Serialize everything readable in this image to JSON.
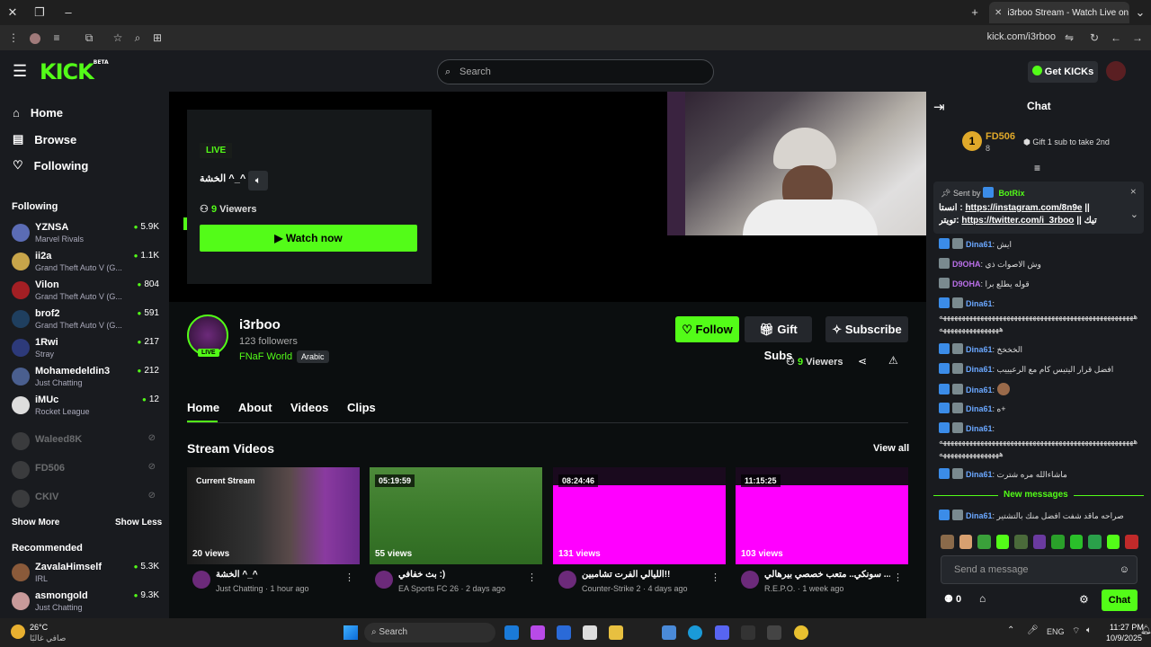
{
  "browser": {
    "tab_title": "i3rboo Stream - Watch Live on",
    "url": "kick.com/i3rboo"
  },
  "header": {
    "logo": "KICK",
    "logo_sup": "BETA",
    "search_placeholder": "Search",
    "get_kicks": "Get KICKs"
  },
  "sidebar": {
    "nav": [
      {
        "label": "Home"
      },
      {
        "label": "Browse"
      },
      {
        "label": "Following"
      }
    ],
    "following_title": "Following",
    "following": [
      {
        "name": "YZNSA",
        "game": "Marvel Rivals",
        "viewers": "5.9K",
        "color": "#5b6cb5"
      },
      {
        "name": "ii2a",
        "game": "Grand Theft Auto V (G...",
        "viewers": "1.1K",
        "color": "#c8a54a"
      },
      {
        "name": "Vilon",
        "game": "Grand Theft Auto V (G...",
        "viewers": "804",
        "color": "#a31f24"
      },
      {
        "name": "brof2",
        "game": "Grand Theft Auto V (G...",
        "viewers": "591",
        "color": "#1f3f5f"
      },
      {
        "name": "1Rwi",
        "game": "Stray",
        "viewers": "217",
        "color": "#2d3a7a"
      },
      {
        "name": "Mohamedeldin3",
        "game": "Just Chatting",
        "viewers": "212",
        "color": "#4a5f8f"
      },
      {
        "name": "iMUc",
        "game": "Rocket League",
        "viewers": "12",
        "color": "#ddd"
      }
    ],
    "offline": [
      {
        "name": "Waleed8K"
      },
      {
        "name": "FD506"
      },
      {
        "name": "CKIV"
      }
    ],
    "show_more": "Show More",
    "show_less": "Show Less",
    "recommended_title": "Recommended",
    "recommended": [
      {
        "name": "ZavalaHimself",
        "game": "IRL",
        "viewers": "5.3K",
        "color": "#8a5a3a"
      },
      {
        "name": "asmongold",
        "game": "Just Chatting",
        "viewers": "9.3K",
        "color": "#c89a9a"
      }
    ]
  },
  "player": {
    "live": "LIVE",
    "title": "الخشة ^_^",
    "viewers_count": "9",
    "viewers_label": "Viewers",
    "watch_now": "Watch now"
  },
  "channel": {
    "name": "i3rboo",
    "followers": "123 followers",
    "category": "FNaF World",
    "language": "Arabic",
    "live_badge": "LIVE",
    "follow": "Follow",
    "gift_subs": "Gift Subs",
    "subscribe": "Subscribe",
    "viewers_count": "9",
    "viewers_label": "Viewers"
  },
  "tabs": [
    {
      "label": "Home"
    },
    {
      "label": "About"
    },
    {
      "label": "Videos"
    },
    {
      "label": "Clips"
    }
  ],
  "videos_section": {
    "title": "Stream Videos",
    "view_all": "View all",
    "videos": [
      {
        "duration": "Current Stream",
        "views": "20 views",
        "title": "الخشة ^_^",
        "meta": "Just Chatting · 1 hour ago"
      },
      {
        "duration": "05:19:59",
        "views": "55 views",
        "title": "بث خفافي :)",
        "meta": "EA Sports FC 26 · 2 days ago"
      },
      {
        "duration": "08:24:46",
        "views": "131 views",
        "title": "الليالي الفرت تشامبين!!",
        "meta": "Counter-Strike 2 · 4 days ago"
      },
      {
        "duration": "11:15:25",
        "views": "103 views",
        "title": "سونكي.. متعب خصصي بيرهالي ...",
        "meta": "R.E.P.O. · 1 week ago"
      }
    ]
  },
  "chat": {
    "title": "Chat",
    "top_gifter": {
      "rank": "1",
      "name": "FD506",
      "count": "8"
    },
    "gift_text": "Gift 1 sub to take 2nd",
    "pinned": {
      "sent_by": "Sent by",
      "bot": "BotRix",
      "line1_prefix": "انستا :",
      "link1": "https://instagram.com/8n9e",
      "sep": "||",
      "line2_prefix": "تويتر:",
      "link2": "https://twitter.com/i_3rboo",
      "line2_suffix": "|| تيك"
    },
    "messages": [
      {
        "user": "Dina61",
        "text": "ايش",
        "color": "blue"
      },
      {
        "user": "D9OHA",
        "text": "وش الاصوات ذي",
        "color": "purple"
      },
      {
        "user": "D9OHA",
        "text": "قوله يطلع برا",
        "color": "purple"
      },
      {
        "user": "Dina61",
        "text": "ههههههههههههههههههههههههههههههههههههههههههههههههههههه ههههههههههههههههه",
        "color": "blue"
      },
      {
        "user": "Dina61",
        "text": "الخخخخ",
        "color": "blue"
      },
      {
        "user": "Dina61",
        "text": "افضل قرار اليتيس كام مع الرعيييب",
        "color": "blue"
      },
      {
        "user": "Dina61",
        "text": "",
        "color": "blue"
      },
      {
        "user": "Dina61",
        "text": "ه+",
        "color": "blue"
      },
      {
        "user": "Dina61",
        "text": "ههههههههههههههههههههههههههههههههههههههههههههههههههههه ههههههههههههههههه",
        "color": "blue"
      },
      {
        "user": "Dina61",
        "text": "ماشاءالله مره شترت",
        "color": "blue"
      }
    ],
    "new_messages": "New messages",
    "last_message": {
      "user": "Dina61",
      "text": "صراحه ماقد شفت افضل منك بالتشتير"
    },
    "input_placeholder": "Send a message",
    "kicks_count": "0",
    "send": "Chat"
  },
  "taskbar": {
    "weather_temp": "26°C",
    "weather_desc": "صافي غالبًا",
    "search": "Search",
    "lang": "ENG",
    "time": "11:27 PM",
    "date": "10/9/2025"
  }
}
